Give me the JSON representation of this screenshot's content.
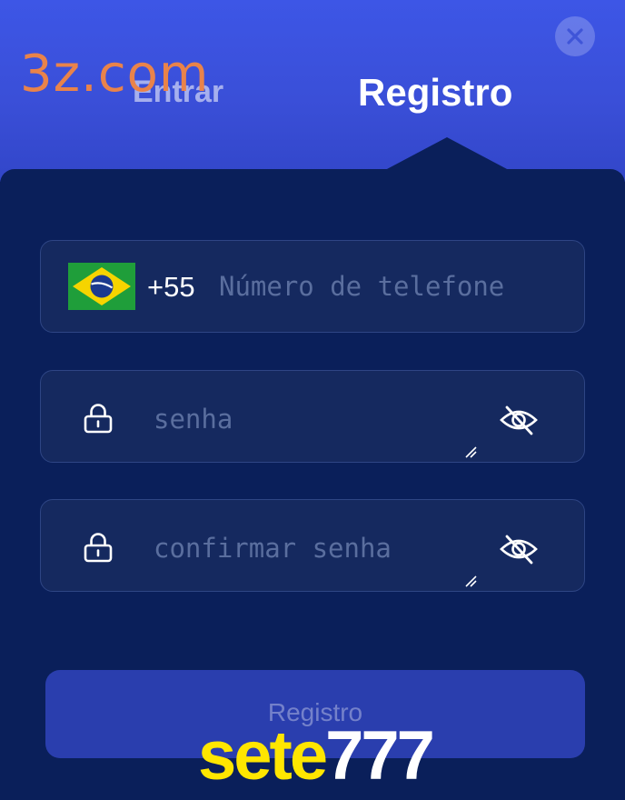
{
  "tabs": {
    "login_label": "Entrar",
    "register_label": "Registro",
    "active": "register"
  },
  "phone_field": {
    "country_code": "+55",
    "placeholder": "Número de telefone",
    "value": ""
  },
  "password_field": {
    "placeholder": "senha",
    "value": ""
  },
  "confirm_password_field": {
    "placeholder": "confirmar senha",
    "value": ""
  },
  "submit_button": {
    "label": "Registro"
  },
  "watermarks": {
    "top": "3z.com",
    "bottom_part1": "sete",
    "bottom_part2": "777"
  },
  "icons": {
    "close": "close-icon",
    "flag": "brazil-flag-icon",
    "lock": "lock-icon",
    "eye_hidden": "eye-off-icon"
  },
  "colors": {
    "header_gradient_top": "#3d56e6",
    "panel_background": "#0a1f5a",
    "field_background": "#15295f",
    "field_border": "#2e4584",
    "button_background": "#2a3eae",
    "placeholder_text": "#5a6e9e",
    "watermark_orange": "#e9834a",
    "watermark_yellow": "#ffe600"
  }
}
